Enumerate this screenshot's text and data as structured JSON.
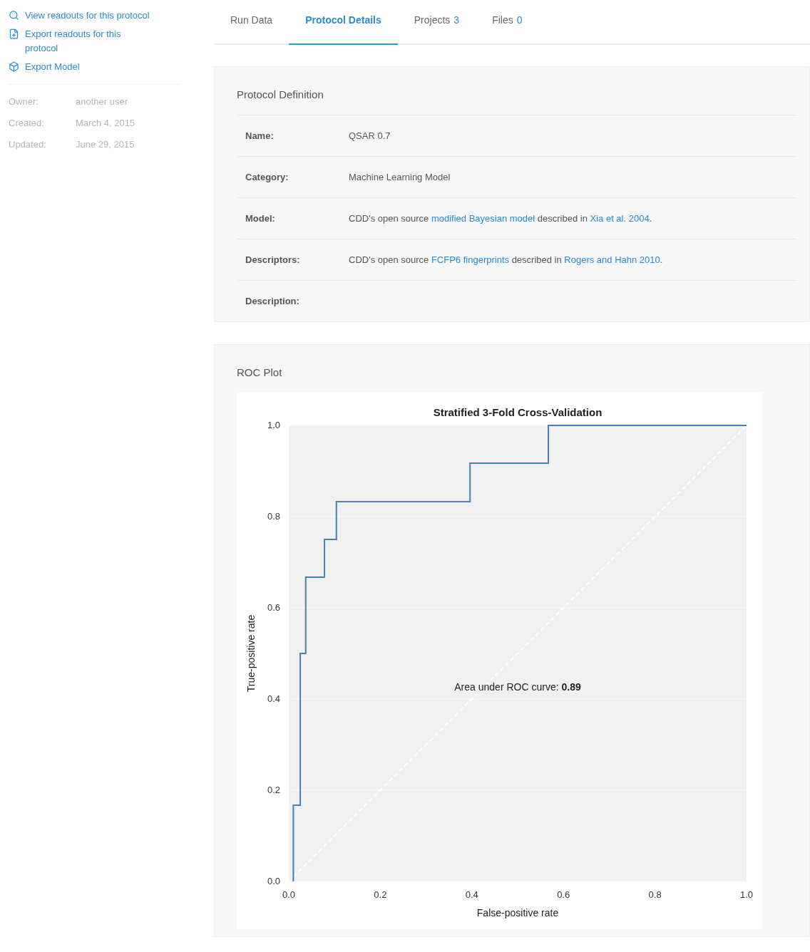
{
  "sidebar": {
    "actions": [
      {
        "kind": "search",
        "label": "View readouts for this protocol"
      },
      {
        "kind": "export",
        "label": "Export readouts for this protocol"
      },
      {
        "kind": "model",
        "label": "Export Model"
      }
    ],
    "meta": [
      {
        "label": "Owner:",
        "value": "another user"
      },
      {
        "label": "Created:",
        "value": "March 4, 2015"
      },
      {
        "label": "Updated:",
        "value": "June 29, 2015"
      }
    ]
  },
  "tabs": [
    {
      "label": "Run Data",
      "selected": false
    },
    {
      "label": "Protocol Details",
      "selected": true
    },
    {
      "label": "Projects",
      "count": "3",
      "selected": false
    },
    {
      "label": "Files",
      "count": "0",
      "selected": false
    }
  ],
  "protocol_definition": {
    "title": "Protocol Definition",
    "rows": [
      {
        "label": "Name:",
        "value": [
          {
            "text": "QSAR 0.7",
            "link": false
          }
        ]
      },
      {
        "label": "Category:",
        "value": [
          {
            "text": "Machine Learning Model",
            "link": false
          }
        ]
      },
      {
        "label": "Model:",
        "value": [
          {
            "text": "CDD's open source ",
            "link": false
          },
          {
            "text": "modified Bayesian model",
            "link": true
          },
          {
            "text": " described in ",
            "link": false
          },
          {
            "text": "Xia et al. 2004",
            "link": true
          },
          {
            "text": ".",
            "link": false
          }
        ]
      },
      {
        "label": "Descriptors:",
        "value": [
          {
            "text": "CDD's open source ",
            "link": false
          },
          {
            "text": "FCFP6 fingerprints",
            "link": true
          },
          {
            "text": " described in ",
            "link": false
          },
          {
            "text": "Rogers and Hahn 2010",
            "link": true
          },
          {
            "text": ".",
            "link": false
          }
        ]
      },
      {
        "label": "Description:",
        "value": []
      }
    ]
  },
  "roc_plot": {
    "title": "ROC Plot",
    "chart_data": {
      "type": "line",
      "title": "Stratified 3-Fold Cross-Validation",
      "xlabel": "False-positive rate",
      "ylabel": "True-positive rate",
      "x": [
        0.01,
        0.01,
        0.025,
        0.025,
        0.037,
        0.037,
        0.078,
        0.078,
        0.104,
        0.104,
        0.396,
        0.396,
        0.567,
        0.567,
        1.0
      ],
      "series": [
        {
          "color": "#4a7fb0",
          "values": [
            0,
            0.167,
            0.167,
            0.5,
            0.5,
            0.667,
            0.667,
            0.75,
            0.75,
            0.833,
            0.833,
            0.917,
            0.917,
            1.0,
            1.0
          ]
        },
        {
          "color": "#ffffff",
          "line_style": "dashed",
          "values": [
            0.01,
            0.01,
            0.025,
            0.025,
            0.037,
            0.037,
            0.078,
            0.078,
            0.104,
            0.104,
            0.396,
            0.396,
            0.567,
            0.567,
            1.0
          ]
        }
      ],
      "xlim": [
        0,
        1
      ],
      "ylim": [
        0,
        1
      ],
      "xticks": [
        {
          "value": 0,
          "label": "0.0"
        },
        {
          "value": 0.2,
          "label": "0.2"
        },
        {
          "value": 0.4,
          "label": "0.4"
        },
        {
          "value": 0.6,
          "label": "0.6"
        },
        {
          "value": 0.8,
          "label": "0.8"
        },
        {
          "value": 1,
          "label": "1.0"
        }
      ],
      "yticks": [
        {
          "value": 0,
          "label": "0.0"
        },
        {
          "value": 0.2,
          "label": "0.2"
        },
        {
          "value": 0.4,
          "label": "0.4"
        },
        {
          "value": 0.6,
          "label": "0.6"
        },
        {
          "value": 0.8,
          "label": "0.8"
        },
        {
          "value": 1,
          "label": "1.0"
        }
      ],
      "annotations": [
        "Area under ROC curve: **0.89**"
      ]
    }
  }
}
